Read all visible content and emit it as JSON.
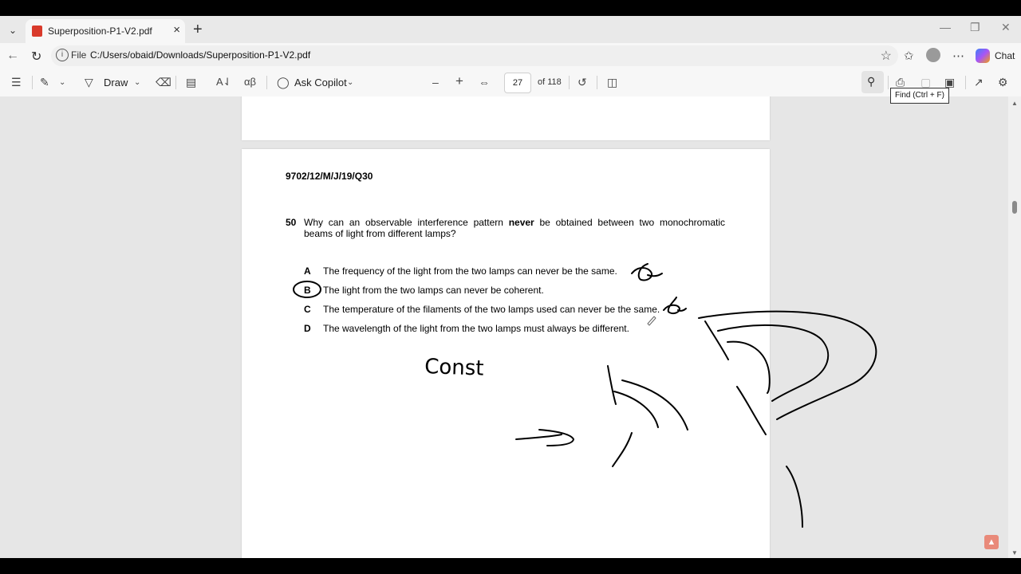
{
  "browser": {
    "tab_title": "Superposition-P1-V2.pdf",
    "address_prefix": "File",
    "address_path": "C:/Users/obaid/Downloads/Superposition-P1-V2.pdf",
    "chat_label": "Chat"
  },
  "pdf_toolbar": {
    "draw_label": "Draw",
    "copilot_label": "Ask Copilot",
    "page_number": "27",
    "page_total": "of 118",
    "find_tooltip": "Find (Ctrl + F)"
  },
  "document": {
    "question_id": "9702/12/M/J/19/Q30",
    "question_number": "50",
    "question_before": "Why can an observable interference pattern ",
    "question_emphasis": "never",
    "question_after": " be obtained between two monochromatic beams of light from different lamps?",
    "options": [
      {
        "letter": "A",
        "text": "The frequency of the light from the two lamps can never be the same."
      },
      {
        "letter": "B",
        "text": "The light from the two lamps can never be coherent."
      },
      {
        "letter": "C",
        "text": "The temperature of the filaments of the two lamps used can never be the same."
      },
      {
        "letter": "D",
        "text": "The wavelength of the light from the two lamps must always be different."
      }
    ],
    "selected_option": "B",
    "handwritten_note": "Const"
  },
  "icons": [
    "tab-list-icon",
    "pdf-file-icon",
    "close-icon",
    "plus-icon",
    "back-icon",
    "reload-icon",
    "info-icon",
    "star-icon",
    "favorites-icon",
    "profile-icon",
    "more-icon",
    "copilot-icon",
    "contents-icon",
    "highlight-icon",
    "draw-icon",
    "eraser-icon",
    "textbox-icon",
    "read-aloud-icon",
    "translate-icon",
    "zoom-out-icon",
    "zoom-in-icon",
    "fit-width-icon",
    "rotate-icon",
    "page-view-icon",
    "search-icon",
    "print-icon",
    "save-icon",
    "save-as-icon",
    "fullscreen-icon",
    "settings-icon"
  ],
  "colors": {
    "ink": "#000000",
    "pdf_red": "#d93a2b",
    "viewer_bg": "#e6e6e6"
  }
}
